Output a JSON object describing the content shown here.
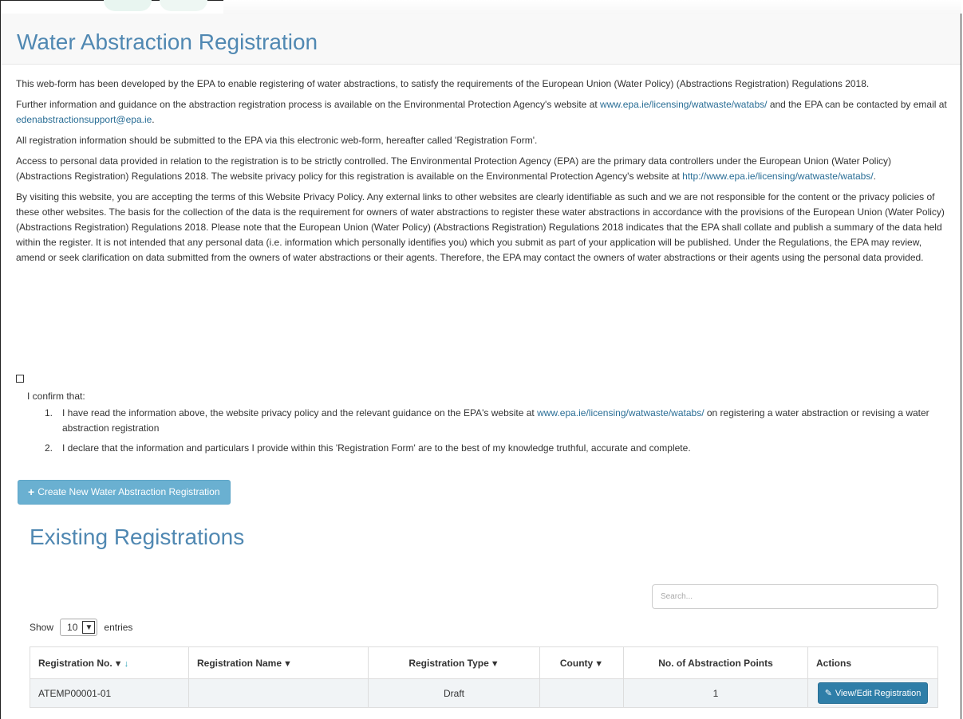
{
  "page": {
    "title": "Water Abstraction Registration"
  },
  "intro": {
    "p1": "This web-form has been developed by the EPA to enable registering of water abstractions, to satisfy the requirements of the European Union (Water Policy) (Abstractions Registration) Regulations 2018.",
    "p2_a": "Further information and guidance on the abstraction registration process is available on the Environmental Protection Agency's website at ",
    "p2_link": "www.epa.ie/licensing/watwaste/watabs/",
    "p2_b": " and the EPA can be contacted by email at ",
    "p2_email": "edenabstractionsupport@epa.ie",
    "p2_c": ".",
    "p3": "All registration information should be submitted to the EPA via this electronic web-form, hereafter called 'Registration Form'.",
    "p4_a": "Access to personal data provided in relation to the registration is to be strictly controlled. The Environmental Protection Agency (EPA) are the primary data controllers under the European Union (Water Policy) (Abstractions Registration) Regulations 2018. The website privacy policy for this registration is available on the Environmental Protection Agency's website at ",
    "p4_link": "http://www.epa.ie/licensing/watwaste/watabs/",
    "p4_b": ".",
    "p5": "By visiting this website, you are accepting the terms of this Website Privacy Policy. Any external links to other websites are clearly identifiable as such and we are not responsible for the content or the privacy policies of these other websites. The basis for the collection of the data is the requirement for owners of water abstractions to register these water abstractions in accordance with the provisions of the European Union (Water Policy) (Abstractions Registration) Regulations 2018. Please note that the European Union (Water Policy) (Abstractions Registration) Regulations 2018 indicates that the EPA shall collate and publish a summary of the data held within the register. It is not intended that any personal data (i.e. information which personally identifies you) which you submit as part of your application will be published. Under the Regulations, the EPA may review, amend or seek clarification on data submitted from the owners of water abstractions or their agents. Therefore, the EPA may contact the owners of water abstractions or their agents using the personal data provided."
  },
  "confirm": {
    "checked": false,
    "label": "I confirm that:",
    "item1_num": "1.",
    "item1_a": "I have read the information above, the website privacy policy and the relevant guidance on the EPA's website at ",
    "item1_link": "www.epa.ie/licensing/watwaste/watabs/",
    "item1_b": " on registering a water abstraction or revising a water abstraction registration",
    "item2_num": "2.",
    "item2": "I declare that the information and particulars I provide within this 'Registration Form' are to the best of my knowledge truthful, accurate and complete."
  },
  "actions": {
    "create_label": "Create New Water Abstraction Registration",
    "create_icon": "plus-icon"
  },
  "existing": {
    "title": "Existing Registrations",
    "search_placeholder": "Search...",
    "show_label": "Show",
    "page_size": "10",
    "entries_label": "entries",
    "columns": {
      "reg_no": "Registration No.",
      "reg_name": "Registration Name",
      "reg_type": "Registration Type",
      "county": "County",
      "points": "No. of Abstraction Points",
      "actions": "Actions"
    },
    "rows": [
      {
        "reg_no": "ATEMP00001-01",
        "reg_name": "",
        "reg_type": "Draft",
        "county": "",
        "points": "1",
        "action_label": "View/Edit Registration"
      }
    ]
  },
  "colors": {
    "title": "#5088b2",
    "link": "#2a6e96",
    "create_button": "#6ab0d1",
    "view_button": "#2f7ea8",
    "sort_icon": "#2aa4b6"
  }
}
